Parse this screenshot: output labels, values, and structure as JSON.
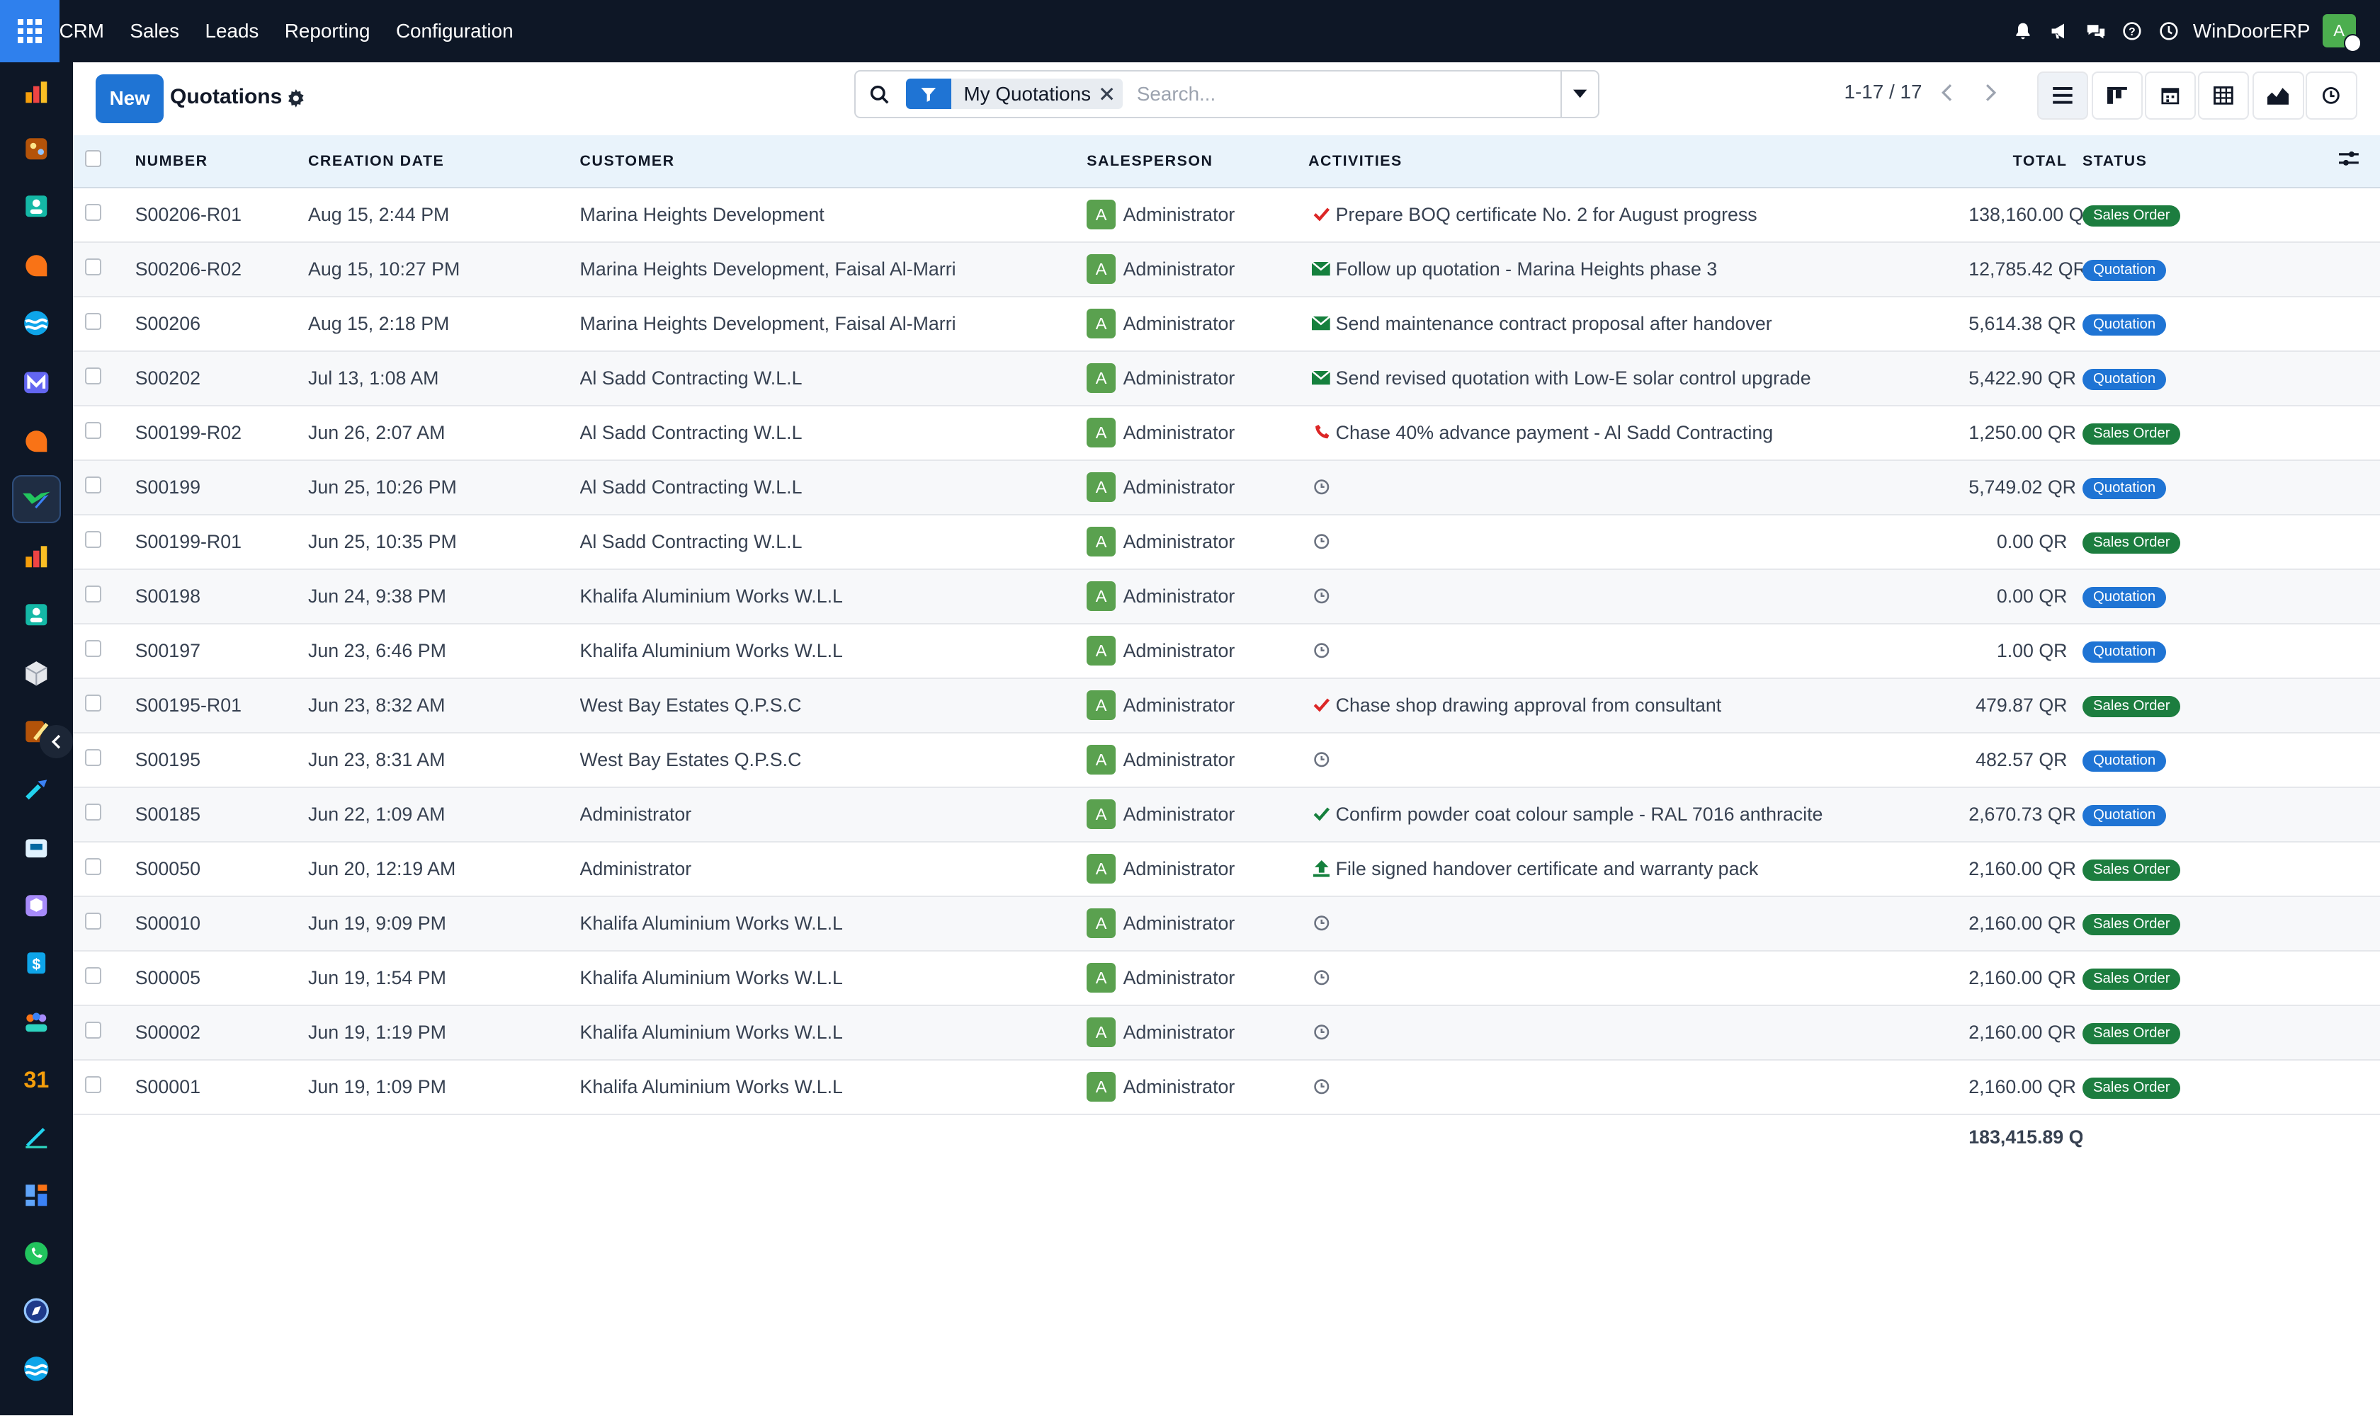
{
  "app": {
    "nav": [
      "CRM",
      "Sales",
      "Leads",
      "Reporting",
      "Configuration"
    ],
    "company": "WinDoorERP",
    "user_initial": "A"
  },
  "toolbar": {
    "new_label": "New",
    "title": "Quotations",
    "filter_facet": "My Quotations",
    "search_placeholder": "Search...",
    "pager": "1-17 / 17"
  },
  "table": {
    "headers": {
      "number": "NUMBER",
      "creation_date": "CREATION DATE",
      "customer": "CUSTOMER",
      "salesperson": "SALESPERSON",
      "activities": "ACTIVITIES",
      "total": "TOTAL",
      "status": "STATUS"
    },
    "rows": [
      {
        "number": "S00206-R01",
        "date": "Aug 15, 2:44 PM",
        "customer": "Marina Heights Development",
        "salesperson": "Administrator",
        "avatar": "A",
        "activity_icon": "check",
        "activity": "Prepare BOQ certificate No. 2 for August progress",
        "total": "138,160.00 QR",
        "status": "Sales Order"
      },
      {
        "number": "S00206-R02",
        "date": "Aug 15, 10:27 PM",
        "customer": "Marina Heights Development, Faisal Al-Marri",
        "salesperson": "Administrator",
        "avatar": "A",
        "activity_icon": "email",
        "activity": "Follow up quotation - Marina Heights phase 3",
        "total": "12,785.42 QR",
        "status": "Quotation"
      },
      {
        "number": "S00206",
        "date": "Aug 15, 2:18 PM",
        "customer": "Marina Heights Development, Faisal Al-Marri",
        "salesperson": "Administrator",
        "avatar": "A",
        "activity_icon": "email",
        "activity": "Send maintenance contract proposal after handover",
        "total": "5,614.38 QR",
        "status": "Quotation"
      },
      {
        "number": "S00202",
        "date": "Jul 13, 1:08 AM",
        "customer": "Al Sadd Contracting W.L.L",
        "salesperson": "Administrator",
        "avatar": "A",
        "activity_icon": "email",
        "activity": "Send revised quotation with Low-E solar control upgrade",
        "total": "5,422.90 QR",
        "status": "Quotation"
      },
      {
        "number": "S00199-R02",
        "date": "Jun 26, 2:07 AM",
        "customer": "Al Sadd Contracting W.L.L",
        "salesperson": "Administrator",
        "avatar": "A",
        "activity_icon": "phone",
        "activity": "Chase 40% advance payment - Al Sadd Contracting",
        "total": "1,250.00 QR",
        "status": "Sales Order"
      },
      {
        "number": "S00199",
        "date": "Jun 25, 10:26 PM",
        "customer": "Al Sadd Contracting W.L.L",
        "salesperson": "Administrator",
        "avatar": "A",
        "activity_icon": "clock",
        "activity": "",
        "total": "5,749.02 QR",
        "status": "Quotation"
      },
      {
        "number": "S00199-R01",
        "date": "Jun 25, 10:35 PM",
        "customer": "Al Sadd Contracting W.L.L",
        "salesperson": "Administrator",
        "avatar": "A",
        "activity_icon": "clock",
        "activity": "",
        "total": "0.00 QR",
        "status": "Sales Order"
      },
      {
        "number": "S00198",
        "date": "Jun 24, 9:38 PM",
        "customer": "Khalifa Aluminium Works W.L.L",
        "salesperson": "Administrator",
        "avatar": "A",
        "activity_icon": "clock",
        "activity": "",
        "total": "0.00 QR",
        "status": "Quotation"
      },
      {
        "number": "S00197",
        "date": "Jun 23, 6:46 PM",
        "customer": "Khalifa Aluminium Works W.L.L",
        "salesperson": "Administrator",
        "avatar": "A",
        "activity_icon": "clock",
        "activity": "",
        "total": "1.00 QR",
        "status": "Quotation"
      },
      {
        "number": "S00195-R01",
        "date": "Jun 23, 8:32 AM",
        "customer": "West Bay Estates Q.P.S.C",
        "salesperson": "Administrator",
        "avatar": "A",
        "activity_icon": "check",
        "activity": "Chase shop drawing approval from consultant",
        "total": "479.87 QR",
        "status": "Sales Order"
      },
      {
        "number": "S00195",
        "date": "Jun 23, 8:31 AM",
        "customer": "West Bay Estates Q.P.S.C",
        "salesperson": "Administrator",
        "avatar": "A",
        "activity_icon": "clock",
        "activity": "",
        "total": "482.57 QR",
        "status": "Quotation"
      },
      {
        "number": "S00185",
        "date": "Jun 22, 1:09 AM",
        "customer": "Administrator",
        "salesperson": "Administrator",
        "avatar": "A",
        "activity_icon": "check-green",
        "activity": "Confirm powder coat colour sample - RAL 7016 anthracite",
        "total": "2,670.73 QR",
        "status": "Quotation"
      },
      {
        "number": "S00050",
        "date": "Jun 20, 12:19 AM",
        "customer": "Administrator",
        "salesperson": "Administrator",
        "avatar": "A",
        "activity_icon": "upload",
        "activity": "File signed handover certificate and warranty pack",
        "total": "2,160.00 QR",
        "status": "Sales Order"
      },
      {
        "number": "S00010",
        "date": "Jun 19, 9:09 PM",
        "customer": "Khalifa Aluminium Works W.L.L",
        "salesperson": "Administrator",
        "avatar": "A",
        "activity_icon": "clock",
        "activity": "",
        "total": "2,160.00 QR",
        "status": "Sales Order"
      },
      {
        "number": "S00005",
        "date": "Jun 19, 1:54 PM",
        "customer": "Khalifa Aluminium Works W.L.L",
        "salesperson": "Administrator",
        "avatar": "A",
        "activity_icon": "clock",
        "activity": "",
        "total": "2,160.00 QR",
        "status": "Sales Order"
      },
      {
        "number": "S00002",
        "date": "Jun 19, 1:19 PM",
        "customer": "Khalifa Aluminium Works W.L.L",
        "salesperson": "Administrator",
        "avatar": "A",
        "activity_icon": "clock",
        "activity": "",
        "total": "2,160.00 QR",
        "status": "Sales Order"
      },
      {
        "number": "S00001",
        "date": "Jun 19, 1:09 PM",
        "customer": "Khalifa Aluminium Works W.L.L",
        "salesperson": "Administrator",
        "avatar": "A",
        "activity_icon": "clock",
        "activity": "",
        "total": "2,160.00 QR",
        "status": "Sales Order"
      }
    ],
    "grand_total": "183,415.89 QR"
  },
  "sidebar_apps": [
    "bar-chart-icon",
    "palette-icon",
    "contact-card-icon",
    "chat-bubble-icon",
    "wave-icon",
    "mail-icon",
    "chat-bubble-icon",
    "crm-handshake-icon",
    "bar-chart-icon",
    "contact-card-icon",
    "box-icon",
    "paint-icon",
    "tools-icon",
    "ticket-icon",
    "package-icon",
    "dollar-doc-icon",
    "team-icon",
    "calendar-icon",
    "pen-icon",
    "dashboard-icon",
    "whatsapp-icon",
    "compass-icon",
    "wave-icon"
  ],
  "colors": {
    "topbar": "#0e1726",
    "accent": "#1f74d4",
    "sales_order_badge": "#1c7d3f",
    "quotation_badge": "#1f74d4",
    "avatar": "#5aa14f"
  }
}
